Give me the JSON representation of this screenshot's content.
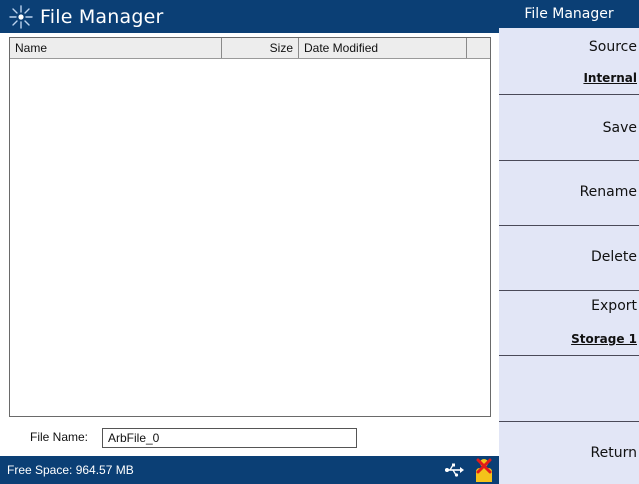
{
  "window": {
    "title": "File Manager",
    "logo_icon": "starburst-logo-icon"
  },
  "file_table": {
    "columns": [
      "Name",
      "Size",
      "Date Modified",
      ""
    ],
    "rows": []
  },
  "file_name": {
    "label": "File Name:",
    "value": "ArbFile_0"
  },
  "status_bar": {
    "text": "Free Space: 964.57 MB",
    "usb_icon": "usb-icon",
    "alert_icon": "warning-person-icon"
  },
  "softkeys": {
    "header": "File Manager",
    "source_label": "Source",
    "source_value": "Internal",
    "save_label": "Save",
    "rename_label": "Rename",
    "delete_label": "Delete",
    "export_label": "Export",
    "export_value": "Storage 1",
    "blank_label": "",
    "return_label": "Return"
  },
  "colors": {
    "title_bar": "#0b3f75",
    "softkey_bg": "#e2e6f6",
    "header_bg": "#ededed"
  }
}
